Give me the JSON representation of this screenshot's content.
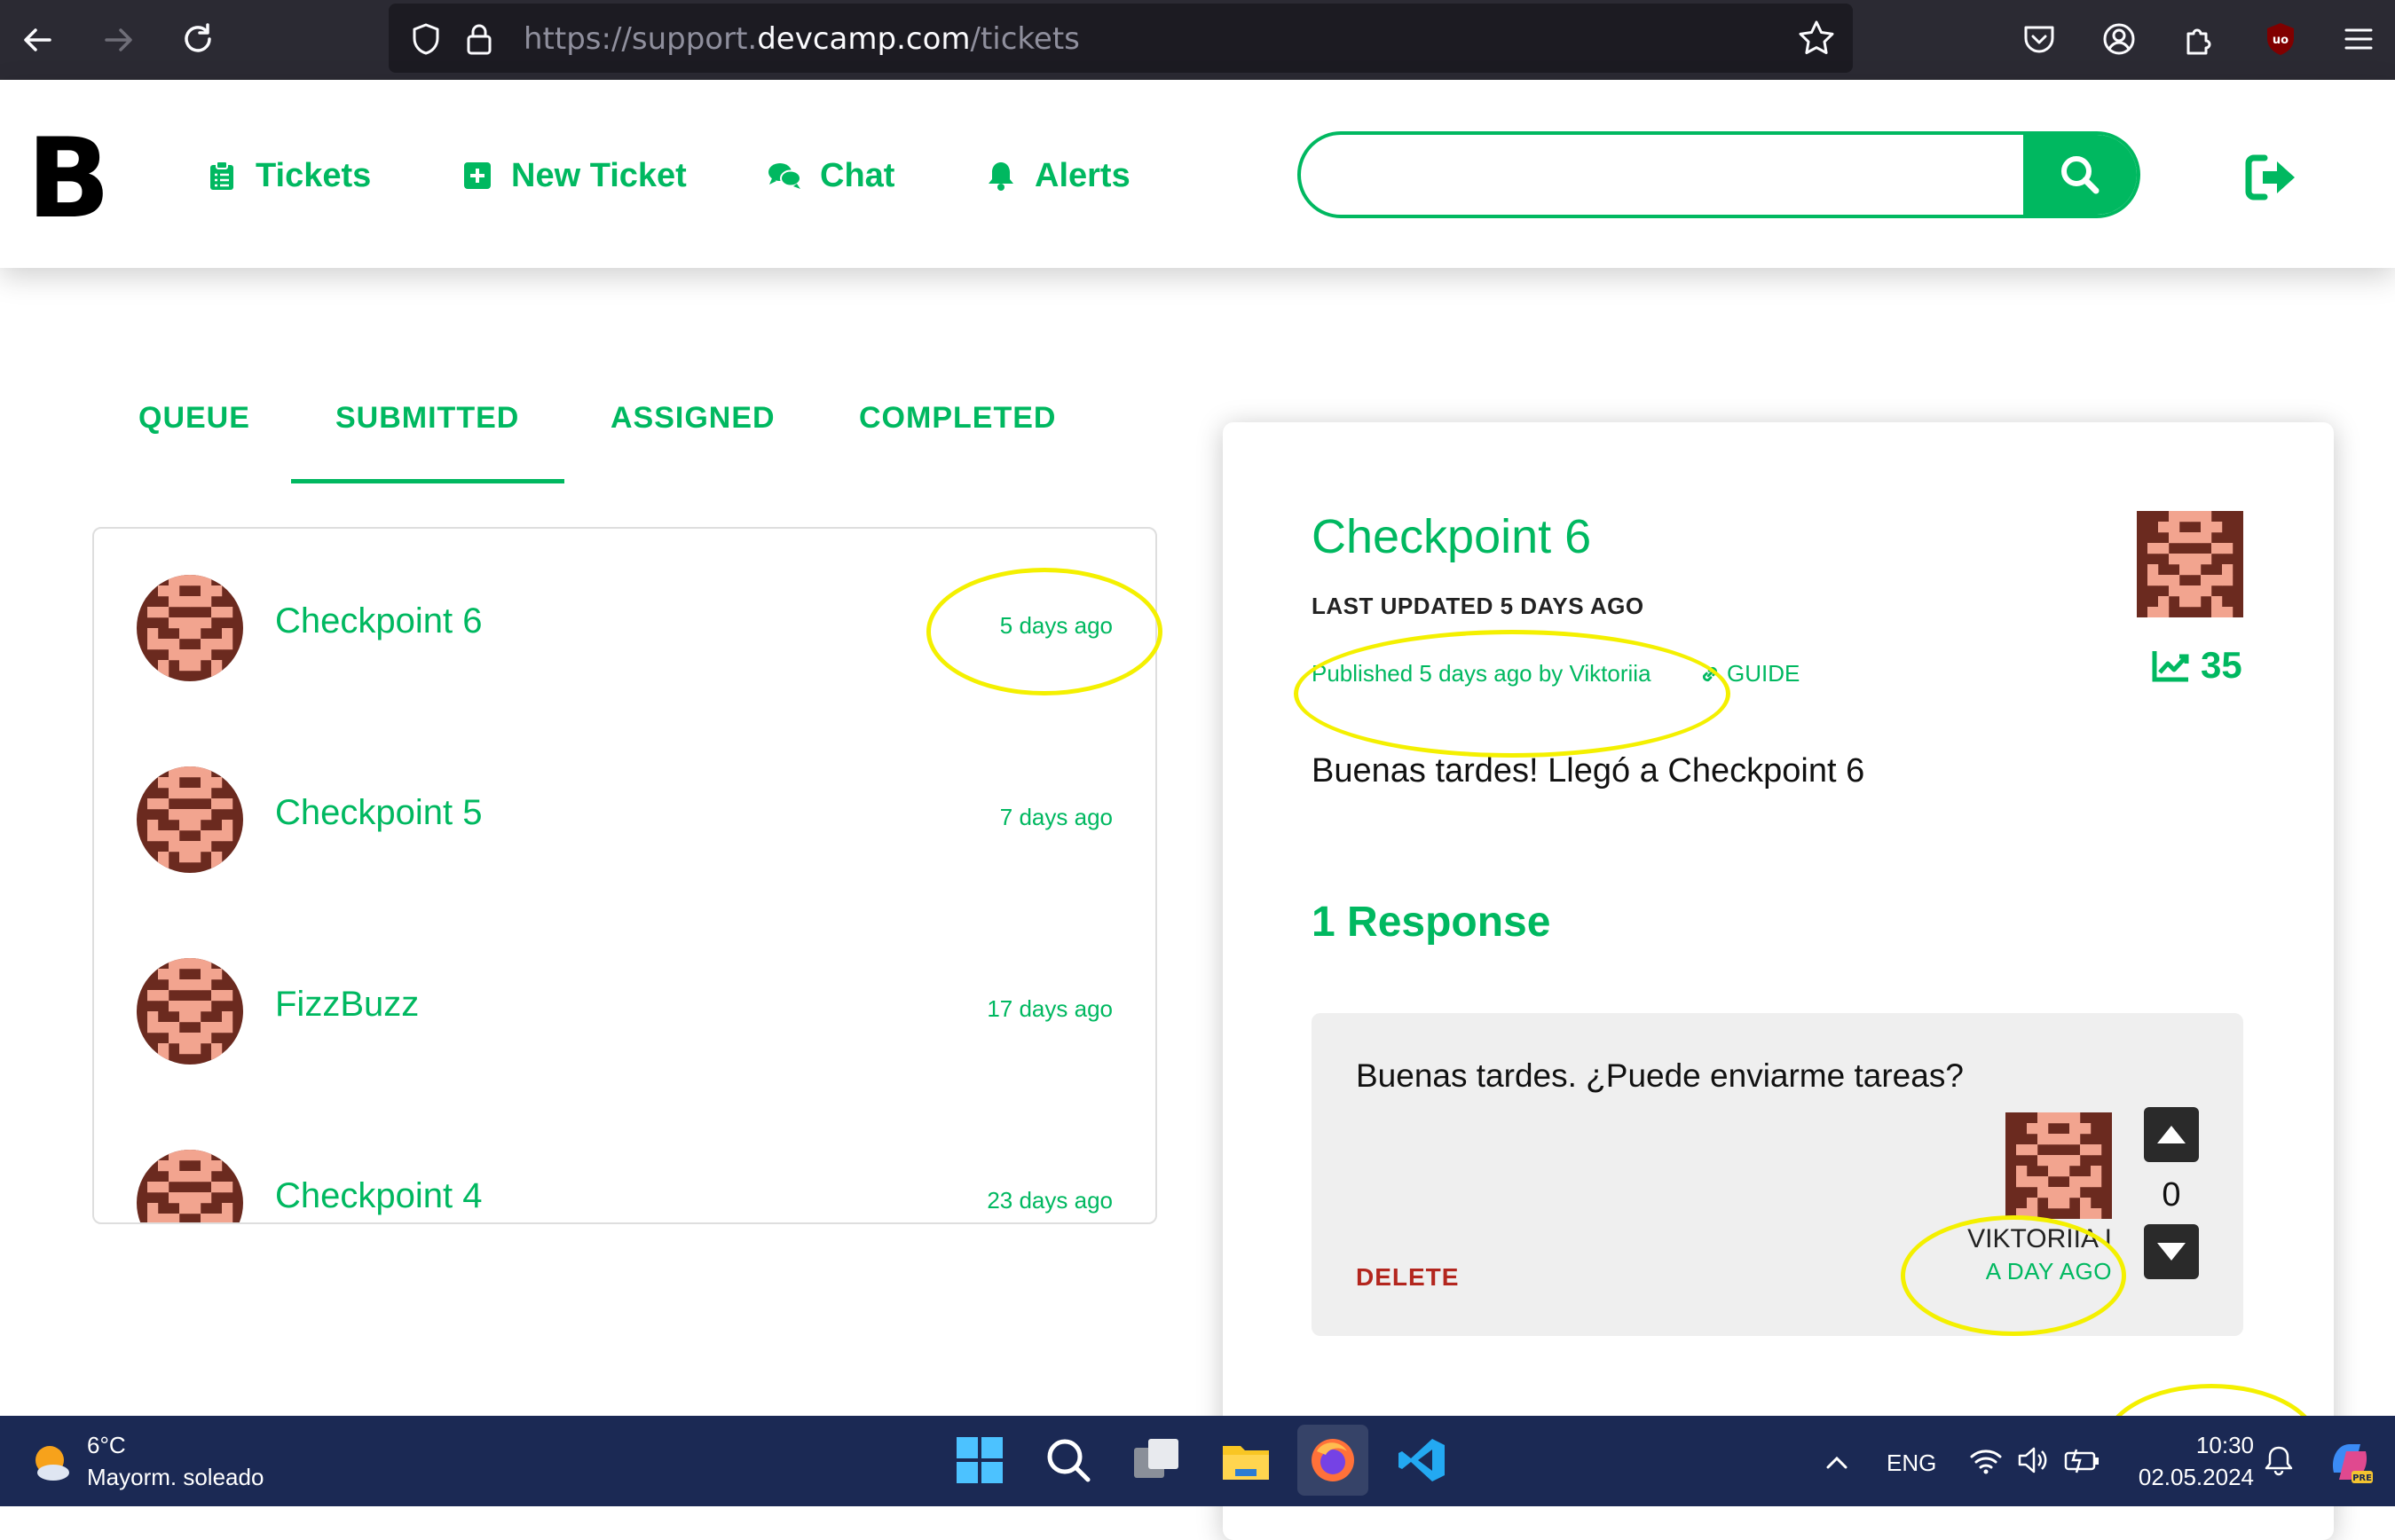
{
  "browser": {
    "url_prefix": "https://support.",
    "url_domain": "devcamp.com",
    "url_path": "/tickets"
  },
  "header": {
    "logo": "B",
    "nav": [
      {
        "label": "Tickets",
        "icon": "clipboard-icon"
      },
      {
        "label": "New Ticket",
        "icon": "plus-square-icon"
      },
      {
        "label": "Chat",
        "icon": "chat-bubbles-icon"
      },
      {
        "label": "Alerts",
        "icon": "bell-icon"
      }
    ],
    "search": {
      "value": "",
      "placeholder": ""
    }
  },
  "tabs": [
    {
      "label": "QUEUE"
    },
    {
      "label": "SUBMITTED",
      "active": true
    },
    {
      "label": "ASSIGNED"
    },
    {
      "label": "COMPLETED"
    }
  ],
  "tickets": [
    {
      "title": "Checkpoint 6",
      "when": "5 days ago"
    },
    {
      "title": "Checkpoint 5",
      "when": "7 days ago"
    },
    {
      "title": "FizzBuzz",
      "when": "17 days ago"
    },
    {
      "title": "Checkpoint 4",
      "when": "23 days ago"
    }
  ],
  "detail": {
    "title": "Checkpoint 6",
    "last_updated": "LAST UPDATED 5 DAYS AGO",
    "published": "Published 5 days ago by Viktoriia",
    "guide": "GUIDE",
    "views": "35",
    "body": "Buenas tardes! Llegó a Checkpoint 6",
    "responses_heading": "1 Response",
    "response": {
      "text": "Buenas tardes. ¿Puede enviarme tareas?",
      "author": "VIKTORIIA I",
      "when": "A DAY AGO",
      "delete_label": "DELETE",
      "votes": "0"
    }
  },
  "taskbar": {
    "temperature": "6°C",
    "weather": "Mayorm. soleado",
    "language": "ENG",
    "time": "10:30",
    "date": "02.05.2024"
  },
  "colors": {
    "accent": "#00b860",
    "browser_bg": "#2b2a33",
    "taskbar_bg": "#1b2954",
    "annotation": "#f4f000",
    "delete": "#b3261e"
  }
}
